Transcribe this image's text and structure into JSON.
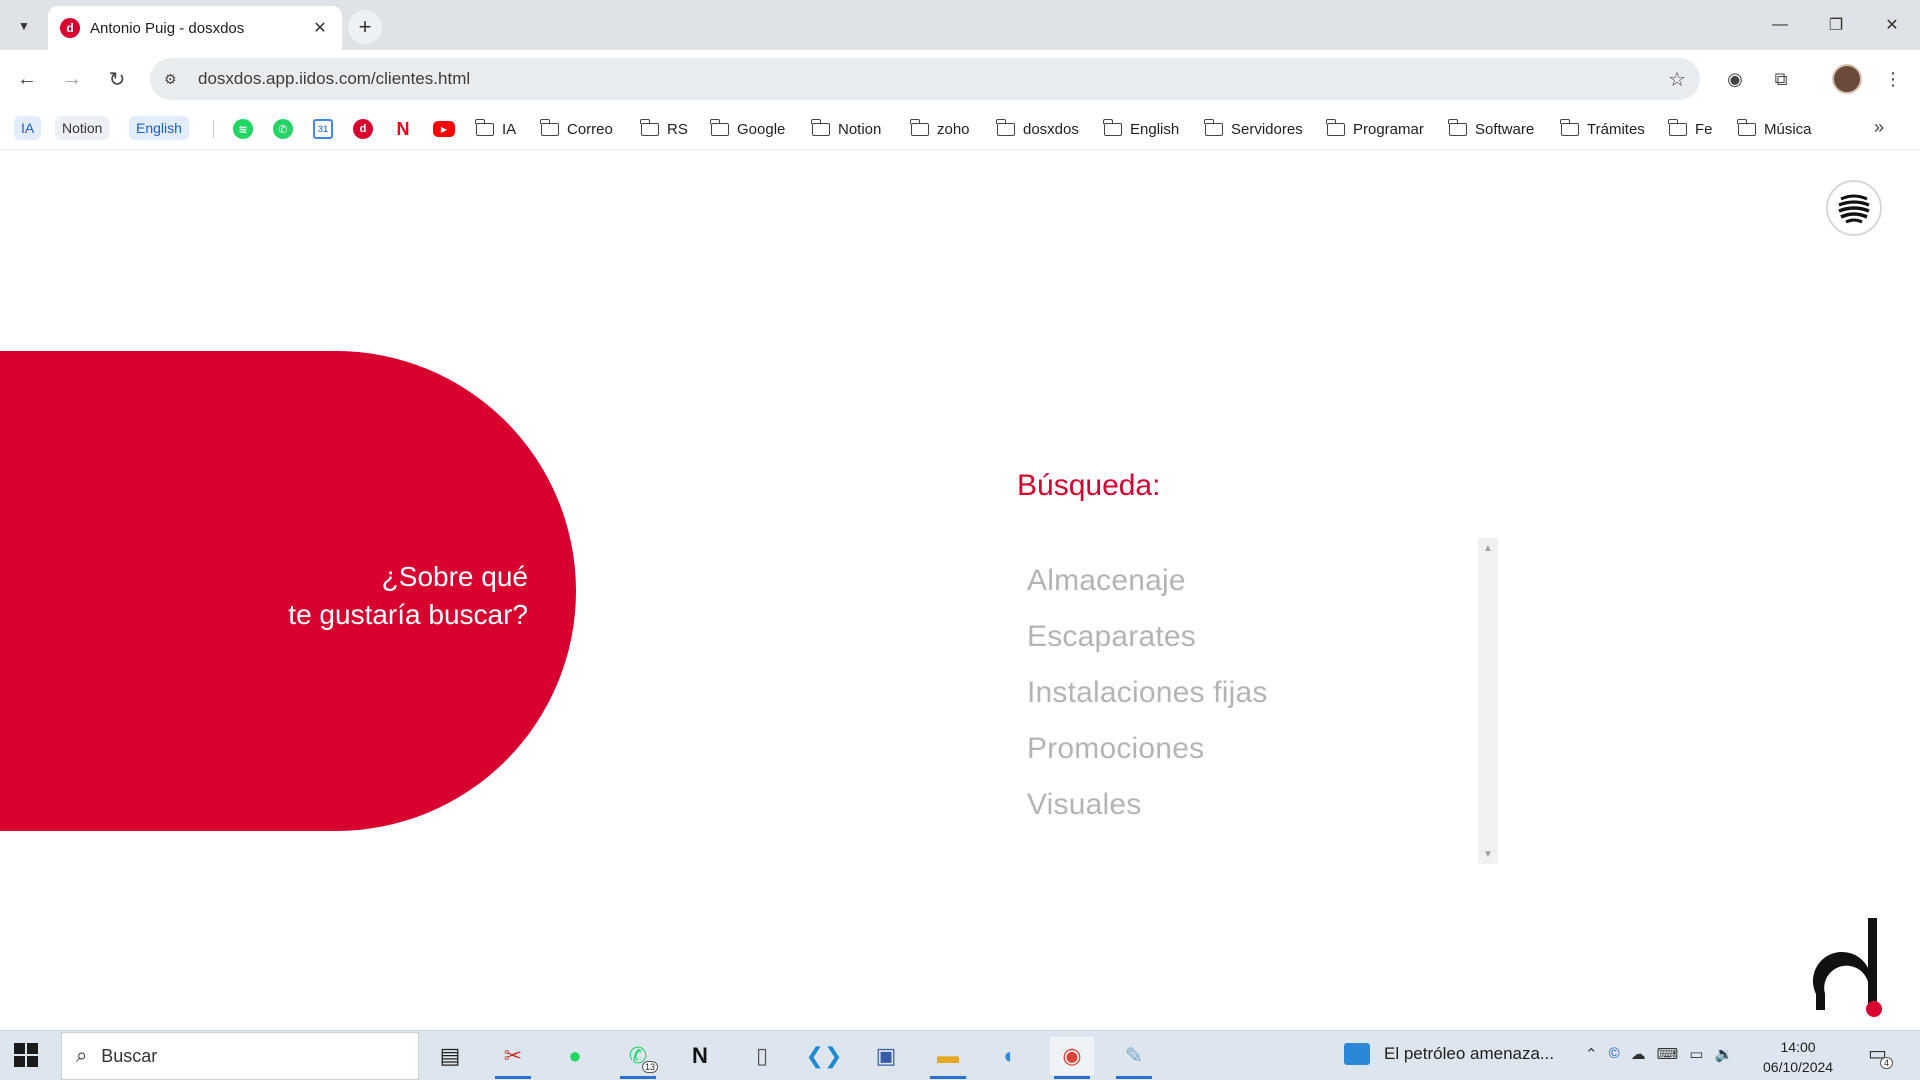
{
  "browser": {
    "tab": {
      "title": "Antonio Puig - dosxdos",
      "close": "✕"
    },
    "new_tab": "+",
    "window_controls": {
      "minimize": "—",
      "maximize": "❐",
      "close": "✕"
    },
    "url": "dosxdos.app.iidos.com/clientes.html",
    "bookmarks": {
      "pills": [
        "IA",
        "Notion",
        "English"
      ],
      "icons": [
        "spotify-icon",
        "whatsapp-icon",
        "calendar-icon",
        "dosxdos-icon",
        "netflix-icon",
        "youtube-icon"
      ],
      "folders": [
        "IA",
        "Correo",
        "RS",
        "Google",
        "Notion",
        "zoho",
        "dosxdos",
        "English",
        "Servidores",
        "Programar",
        "Software",
        "Trámites",
        "Fe",
        "Música"
      ],
      "more": "»"
    }
  },
  "page": {
    "hero": {
      "line1": "¿Sobre qué",
      "line2": "te gustaría buscar?"
    },
    "search_title": "Búsqueda:",
    "options": [
      "Almacenaje",
      "Escaparates",
      "Instalaciones fijas",
      "Promociones",
      "Visuales"
    ]
  },
  "taskbar": {
    "search_placeholder": "Buscar",
    "whatsapp_badge": "13",
    "news": "El petróleo amenaza...",
    "time": "14:00",
    "date": "06/10/2024",
    "notifications": "4"
  },
  "colors": {
    "brand_red": "#d8002f",
    "option_grey": "#b4b4b4"
  }
}
